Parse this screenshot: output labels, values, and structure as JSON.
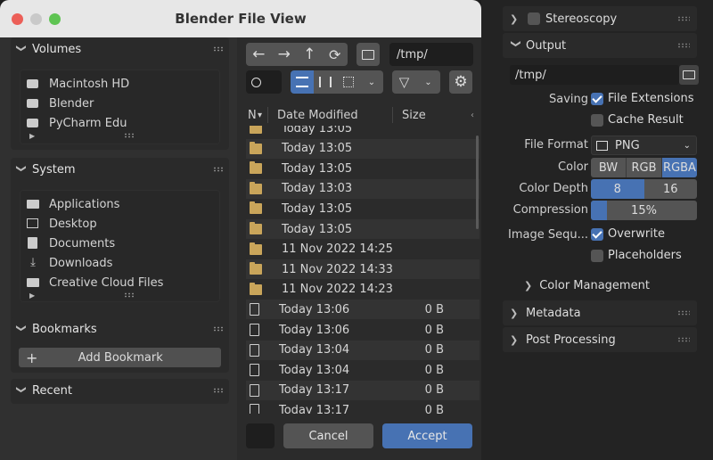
{
  "dialog": {
    "title": "Blender File View",
    "sidebar": {
      "volumes": {
        "title": "Volumes",
        "items": [
          "Macintosh HD",
          "Blender",
          "PyCharm Edu"
        ]
      },
      "system": {
        "title": "System",
        "items": [
          "Applications",
          "Desktop",
          "Documents",
          "Downloads",
          "Creative Cloud Files"
        ]
      },
      "bookmarks": {
        "title": "Bookmarks",
        "add_label": "Add Bookmark"
      },
      "recent": {
        "title": "Recent"
      }
    },
    "toolbar": {
      "path": "/tmp/"
    },
    "columns": {
      "name_short": "N",
      "date": "Date Modified",
      "size": "Size"
    },
    "rows": [
      {
        "type": "folder",
        "date": "Today 13:05",
        "size": ""
      },
      {
        "type": "folder",
        "date": "Today 13:05",
        "size": ""
      },
      {
        "type": "folder",
        "date": "Today 13:05",
        "size": ""
      },
      {
        "type": "folder",
        "date": "Today 13:03",
        "size": ""
      },
      {
        "type": "folder",
        "date": "Today 13:05",
        "size": ""
      },
      {
        "type": "folder",
        "date": "Today 13:05",
        "size": ""
      },
      {
        "type": "folder",
        "date": "11 Nov 2022 14:25",
        "size": ""
      },
      {
        "type": "folder",
        "date": "11 Nov 2022 14:33",
        "size": ""
      },
      {
        "type": "folder",
        "date": "11 Nov 2022 14:23",
        "size": ""
      },
      {
        "type": "file",
        "date": "Today 13:06",
        "size": "0 B"
      },
      {
        "type": "file",
        "date": "Today 13:06",
        "size": "0 B"
      },
      {
        "type": "file",
        "date": "Today 13:04",
        "size": "0 B"
      },
      {
        "type": "file",
        "date": "Today 13:04",
        "size": "0 B"
      },
      {
        "type": "file",
        "date": "Today 13:17",
        "size": "0 B"
      },
      {
        "type": "file",
        "date": "Today 13:17",
        "size": "0 B"
      }
    ],
    "footer": {
      "cancel": "Cancel",
      "accept": "Accept"
    }
  },
  "properties": {
    "stereoscopy": "Stereoscopy",
    "output": {
      "title": "Output",
      "path": "/tmp/",
      "saving_label": "Saving",
      "file_extensions": "File Extensions",
      "cache_result": "Cache Result",
      "file_format_label": "File Format",
      "file_format": "PNG",
      "color_label": "Color",
      "color_options": [
        "BW",
        "RGB",
        "RGBA"
      ],
      "color_selected": "RGBA",
      "color_depth_label": "Color Depth",
      "color_depth_options": [
        "8",
        "16"
      ],
      "color_depth_selected": "8",
      "compression_label": "Compression",
      "compression": "15%",
      "image_sequence_label": "Image Sequ...",
      "overwrite": "Overwrite",
      "placeholders": "Placeholders",
      "color_management": "Color Management"
    },
    "metadata": "Metadata",
    "post_processing": "Post Processing"
  }
}
